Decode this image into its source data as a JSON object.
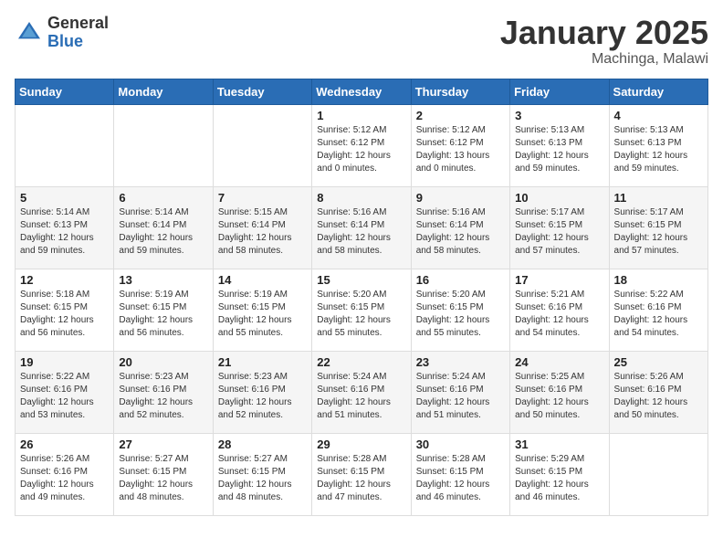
{
  "header": {
    "logo_general": "General",
    "logo_blue": "Blue",
    "month_title": "January 2025",
    "location": "Machinga, Malawi"
  },
  "weekdays": [
    "Sunday",
    "Monday",
    "Tuesday",
    "Wednesday",
    "Thursday",
    "Friday",
    "Saturday"
  ],
  "weeks": [
    [
      {
        "day": "",
        "sunrise": "",
        "sunset": "",
        "daylight": ""
      },
      {
        "day": "",
        "sunrise": "",
        "sunset": "",
        "daylight": ""
      },
      {
        "day": "",
        "sunrise": "",
        "sunset": "",
        "daylight": ""
      },
      {
        "day": "1",
        "sunrise": "Sunrise: 5:12 AM",
        "sunset": "Sunset: 6:12 PM",
        "daylight": "Daylight: 12 hours and 0 minutes."
      },
      {
        "day": "2",
        "sunrise": "Sunrise: 5:12 AM",
        "sunset": "Sunset: 6:12 PM",
        "daylight": "Daylight: 13 hours and 0 minutes."
      },
      {
        "day": "3",
        "sunrise": "Sunrise: 5:13 AM",
        "sunset": "Sunset: 6:13 PM",
        "daylight": "Daylight: 12 hours and 59 minutes."
      },
      {
        "day": "4",
        "sunrise": "Sunrise: 5:13 AM",
        "sunset": "Sunset: 6:13 PM",
        "daylight": "Daylight: 12 hours and 59 minutes."
      }
    ],
    [
      {
        "day": "5",
        "sunrise": "Sunrise: 5:14 AM",
        "sunset": "Sunset: 6:13 PM",
        "daylight": "Daylight: 12 hours and 59 minutes."
      },
      {
        "day": "6",
        "sunrise": "Sunrise: 5:14 AM",
        "sunset": "Sunset: 6:14 PM",
        "daylight": "Daylight: 12 hours and 59 minutes."
      },
      {
        "day": "7",
        "sunrise": "Sunrise: 5:15 AM",
        "sunset": "Sunset: 6:14 PM",
        "daylight": "Daylight: 12 hours and 58 minutes."
      },
      {
        "day": "8",
        "sunrise": "Sunrise: 5:16 AM",
        "sunset": "Sunset: 6:14 PM",
        "daylight": "Daylight: 12 hours and 58 minutes."
      },
      {
        "day": "9",
        "sunrise": "Sunrise: 5:16 AM",
        "sunset": "Sunset: 6:14 PM",
        "daylight": "Daylight: 12 hours and 58 minutes."
      },
      {
        "day": "10",
        "sunrise": "Sunrise: 5:17 AM",
        "sunset": "Sunset: 6:15 PM",
        "daylight": "Daylight: 12 hours and 57 minutes."
      },
      {
        "day": "11",
        "sunrise": "Sunrise: 5:17 AM",
        "sunset": "Sunset: 6:15 PM",
        "daylight": "Daylight: 12 hours and 57 minutes."
      }
    ],
    [
      {
        "day": "12",
        "sunrise": "Sunrise: 5:18 AM",
        "sunset": "Sunset: 6:15 PM",
        "daylight": "Daylight: 12 hours and 56 minutes."
      },
      {
        "day": "13",
        "sunrise": "Sunrise: 5:19 AM",
        "sunset": "Sunset: 6:15 PM",
        "daylight": "Daylight: 12 hours and 56 minutes."
      },
      {
        "day": "14",
        "sunrise": "Sunrise: 5:19 AM",
        "sunset": "Sunset: 6:15 PM",
        "daylight": "Daylight: 12 hours and 55 minutes."
      },
      {
        "day": "15",
        "sunrise": "Sunrise: 5:20 AM",
        "sunset": "Sunset: 6:15 PM",
        "daylight": "Daylight: 12 hours and 55 minutes."
      },
      {
        "day": "16",
        "sunrise": "Sunrise: 5:20 AM",
        "sunset": "Sunset: 6:15 PM",
        "daylight": "Daylight: 12 hours and 55 minutes."
      },
      {
        "day": "17",
        "sunrise": "Sunrise: 5:21 AM",
        "sunset": "Sunset: 6:16 PM",
        "daylight": "Daylight: 12 hours and 54 minutes."
      },
      {
        "day": "18",
        "sunrise": "Sunrise: 5:22 AM",
        "sunset": "Sunset: 6:16 PM",
        "daylight": "Daylight: 12 hours and 54 minutes."
      }
    ],
    [
      {
        "day": "19",
        "sunrise": "Sunrise: 5:22 AM",
        "sunset": "Sunset: 6:16 PM",
        "daylight": "Daylight: 12 hours and 53 minutes."
      },
      {
        "day": "20",
        "sunrise": "Sunrise: 5:23 AM",
        "sunset": "Sunset: 6:16 PM",
        "daylight": "Daylight: 12 hours and 52 minutes."
      },
      {
        "day": "21",
        "sunrise": "Sunrise: 5:23 AM",
        "sunset": "Sunset: 6:16 PM",
        "daylight": "Daylight: 12 hours and 52 minutes."
      },
      {
        "day": "22",
        "sunrise": "Sunrise: 5:24 AM",
        "sunset": "Sunset: 6:16 PM",
        "daylight": "Daylight: 12 hours and 51 minutes."
      },
      {
        "day": "23",
        "sunrise": "Sunrise: 5:24 AM",
        "sunset": "Sunset: 6:16 PM",
        "daylight": "Daylight: 12 hours and 51 minutes."
      },
      {
        "day": "24",
        "sunrise": "Sunrise: 5:25 AM",
        "sunset": "Sunset: 6:16 PM",
        "daylight": "Daylight: 12 hours and 50 minutes."
      },
      {
        "day": "25",
        "sunrise": "Sunrise: 5:26 AM",
        "sunset": "Sunset: 6:16 PM",
        "daylight": "Daylight: 12 hours and 50 minutes."
      }
    ],
    [
      {
        "day": "26",
        "sunrise": "Sunrise: 5:26 AM",
        "sunset": "Sunset: 6:16 PM",
        "daylight": "Daylight: 12 hours and 49 minutes."
      },
      {
        "day": "27",
        "sunrise": "Sunrise: 5:27 AM",
        "sunset": "Sunset: 6:15 PM",
        "daylight": "Daylight: 12 hours and 48 minutes."
      },
      {
        "day": "28",
        "sunrise": "Sunrise: 5:27 AM",
        "sunset": "Sunset: 6:15 PM",
        "daylight": "Daylight: 12 hours and 48 minutes."
      },
      {
        "day": "29",
        "sunrise": "Sunrise: 5:28 AM",
        "sunset": "Sunset: 6:15 PM",
        "daylight": "Daylight: 12 hours and 47 minutes."
      },
      {
        "day": "30",
        "sunrise": "Sunrise: 5:28 AM",
        "sunset": "Sunset: 6:15 PM",
        "daylight": "Daylight: 12 hours and 46 minutes."
      },
      {
        "day": "31",
        "sunrise": "Sunrise: 5:29 AM",
        "sunset": "Sunset: 6:15 PM",
        "daylight": "Daylight: 12 hours and 46 minutes."
      },
      {
        "day": "",
        "sunrise": "",
        "sunset": "",
        "daylight": ""
      }
    ]
  ]
}
